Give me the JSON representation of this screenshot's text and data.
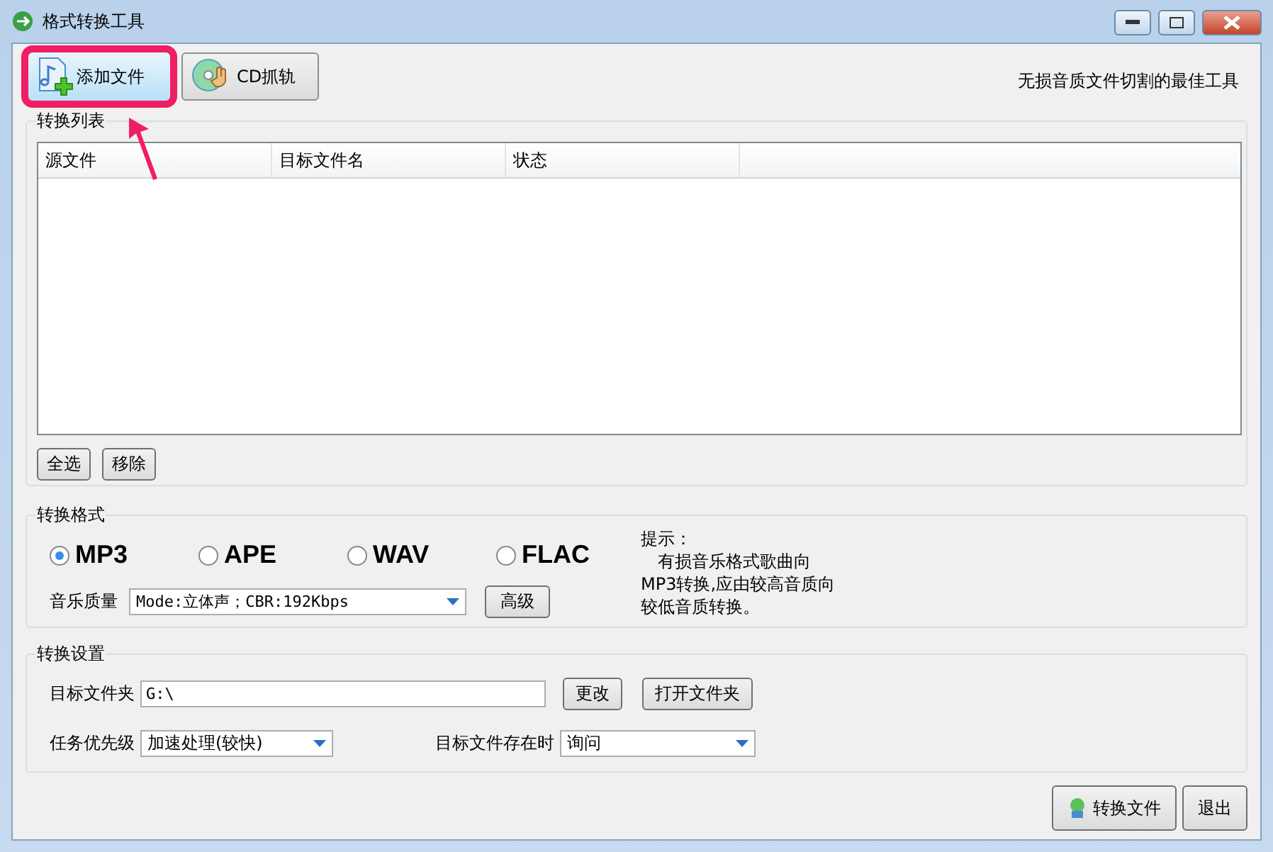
{
  "window": {
    "title": "格式转换工具"
  },
  "toolbar": {
    "buttons": [
      {
        "kind": "add",
        "label": "添加文件",
        "highlighted": true
      },
      {
        "kind": "cd",
        "label": "CD抓轨",
        "highlighted": false
      }
    ],
    "tagline": "无损音质文件切割的最佳工具"
  },
  "conversion_list": {
    "title": "转换列表",
    "columns": [
      "源文件",
      "目标文件名",
      "状态"
    ],
    "buttons": [
      "全选",
      "移除"
    ]
  },
  "format": {
    "title": "转换格式",
    "options": [
      {
        "label": "MP3",
        "selected": true
      },
      {
        "label": "APE",
        "selected": false
      },
      {
        "label": "WAV",
        "selected": false
      },
      {
        "label": "FLAC",
        "selected": false
      }
    ],
    "quality_label": "音乐质量",
    "quality_value": "Mode:立体声；CBR:192Kbps",
    "advanced_button": "高级",
    "hint_title": "提示：",
    "hint_text": "有损音乐格式歌曲向MP3转换,应由较高音质向较低音质转换。"
  },
  "settings": {
    "title": "转换设置",
    "folder_label": "目标文件夹",
    "folder_value": "G:\\",
    "change_button": "更改",
    "open_button": "打开文件夹",
    "priority_label": "任务优先级",
    "priority_value": "加速处理(较快)",
    "exists_label": "目标文件存在时",
    "exists_value": "询问"
  },
  "footer": {
    "buttons": [
      {
        "kind": "convert",
        "label": "转换文件"
      },
      {
        "kind": "exit",
        "label": "退出"
      }
    ]
  }
}
